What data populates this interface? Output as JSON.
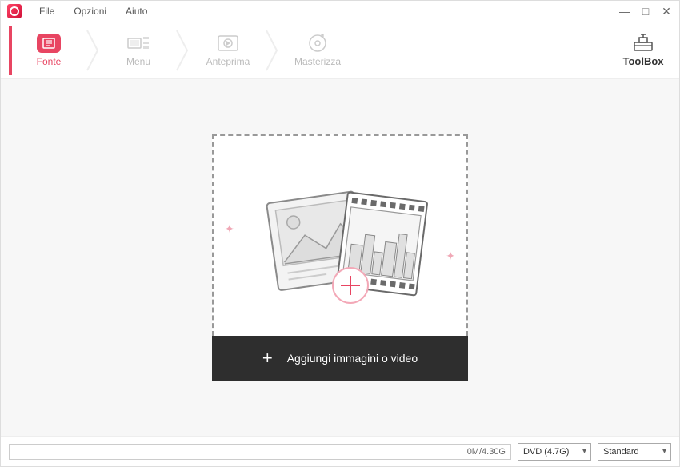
{
  "menubar": {
    "file": "File",
    "options": "Opzioni",
    "help": "Aiuto"
  },
  "steps": {
    "source": "Fonte",
    "menu": "Menu",
    "preview": "Anteprima",
    "burn": "Masterizza"
  },
  "toolbox_label": "ToolBox",
  "dropzone": {
    "button_label": "Aggiungi immagini o video"
  },
  "bottombar": {
    "progress_text": "0M/4.30G",
    "disc_type": "DVD (4.7G)",
    "quality": "Standard"
  }
}
